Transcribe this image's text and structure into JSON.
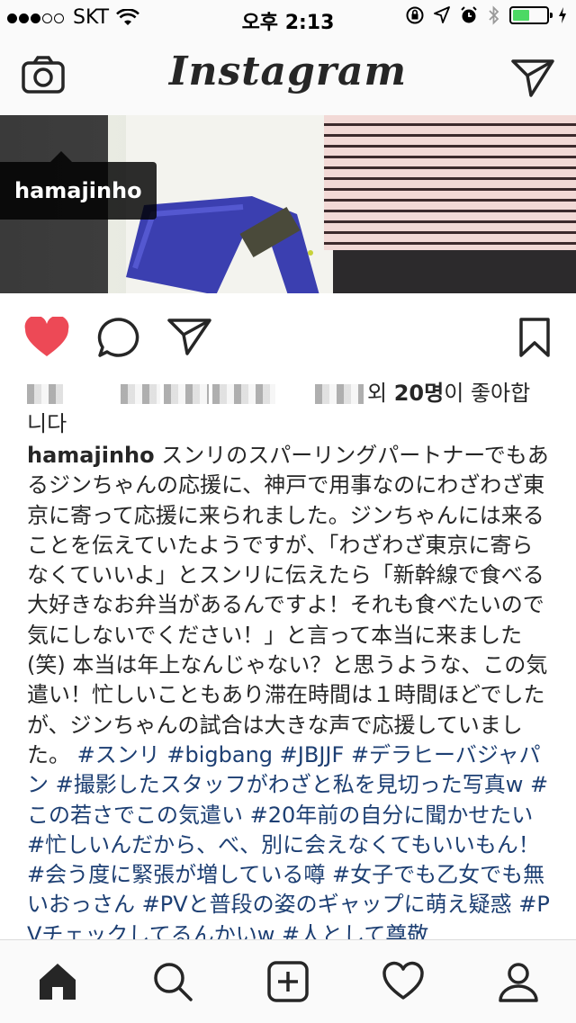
{
  "status_bar": {
    "carrier": "SKT",
    "time": "오후 2:13",
    "signal_strength": 3,
    "battery_level": 0.45,
    "battery_color": "#4cd964"
  },
  "header": {
    "logo_text": "Instagram",
    "left_icon": "camera-icon",
    "right_icon": "direct-send-icon"
  },
  "photo": {
    "tag_username": "hamajinho"
  },
  "actions": {
    "like_icon": "heart-filled-icon",
    "like_color": "#ed4956",
    "comment_icon": "comment-icon",
    "share_icon": "send-icon",
    "save_icon": "bookmark-icon"
  },
  "likes": {
    "suffix_pre": "외 ",
    "count": "20명",
    "suffix_post": "이 좋아합니다"
  },
  "caption": {
    "username": "hamajinho",
    "text": "スンリのスパーリングパートナーでもあるジンちゃんの応援に、神戸で用事なのにわざわざ東京に寄って応援に来られました。ジンちゃんには来ることを伝えていたようですが、「わざわざ東京に寄らなくていいよ」とスンリに伝えたら「新幹線で食べる大好きなお弁当があるんですよ！それも食べたいので気にしないでください！」と言って本当に来ました(笑) 本当は年上なんじゃない？と思うような、この気遣い！忙しいこともあり滞在時間は１時間ほどでしたが、ジンちゃんの試合は大きな声で応援していました。",
    "hashtags": [
      "#スンリ",
      "#bigbang",
      "#JBJJF",
      "#デラヒーバジャパン",
      "#撮影したスタッフがわざと私を見切った写真w",
      "#この若さでこの気遣い",
      "#20年前の自分に聞かせたい",
      "#忙しいんだから、べ、別に会えなくてもいいもん！",
      "#会う度に緊張が増している噂",
      "#女子でも乙女でも無いおっさん",
      "#PVと普段の姿のギャップに萌え疑惑",
      "#PVチェックしてるんかいw",
      "#人として尊敬"
    ],
    "hashtag_color": "#1d3f73"
  },
  "tab_bar": {
    "items": [
      "home-icon",
      "search-icon",
      "add-post-icon",
      "activity-heart-icon",
      "profile-icon"
    ]
  }
}
